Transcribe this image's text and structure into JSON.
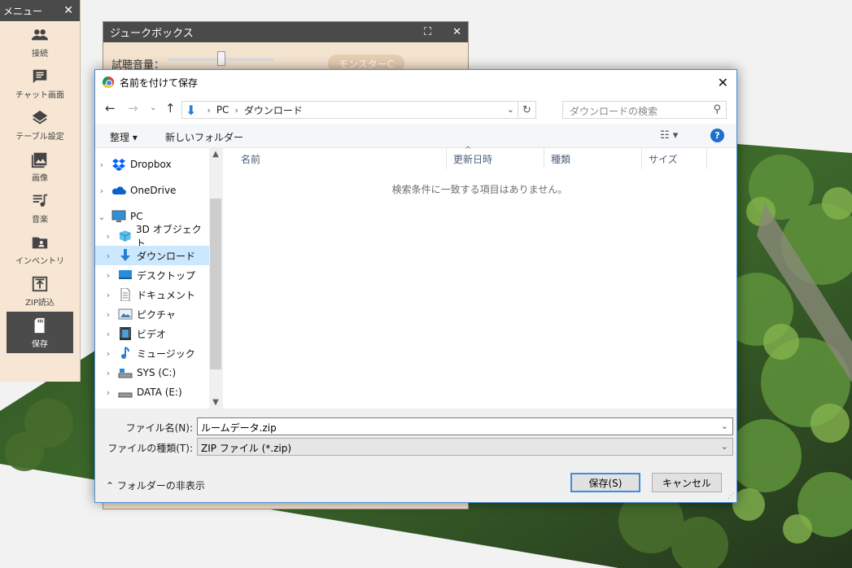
{
  "menu": {
    "title": "メニュー",
    "items": [
      {
        "label": "接続",
        "icon": "people-icon"
      },
      {
        "label": "チャット画面",
        "icon": "chat-icon"
      },
      {
        "label": "テーブル設定",
        "icon": "layers-icon"
      },
      {
        "label": "画像",
        "icon": "image-icon"
      },
      {
        "label": "音楽",
        "icon": "music-icon"
      },
      {
        "label": "インベントリ",
        "icon": "folder-person-icon"
      },
      {
        "label": "ZIP読込",
        "icon": "upload-icon"
      },
      {
        "label": "保存",
        "icon": "sd-card-icon",
        "active": true
      }
    ]
  },
  "jukebox": {
    "title": "ジュークボックス",
    "volume_label": "試聴音量：",
    "pill_label": "モンスターC"
  },
  "dialog": {
    "title": "名前を付けて保存",
    "address": {
      "root": "PC",
      "current": "ダウンロード"
    },
    "search_placeholder": "ダウンロードの検索",
    "commands": {
      "organize": "整理 ▾",
      "new_folder": "新しいフォルダー"
    },
    "nav_items": [
      {
        "label": "Dropbox",
        "icon": "dropbox-icon",
        "indent": 0
      },
      {
        "label": "OneDrive",
        "icon": "onedrive-icon",
        "indent": 0
      },
      {
        "label": "PC",
        "icon": "computer-icon",
        "indent": 0,
        "expanded": true
      },
      {
        "label": "3D オブジェクト",
        "icon": "cube-icon",
        "indent": 1
      },
      {
        "label": "ダウンロード",
        "icon": "download-arrow-icon",
        "indent": 1,
        "selected": true
      },
      {
        "label": "デスクトップ",
        "icon": "desktop-icon",
        "indent": 1
      },
      {
        "label": "ドキュメント",
        "icon": "document-icon",
        "indent": 1
      },
      {
        "label": "ピクチャ",
        "icon": "picture-icon",
        "indent": 1
      },
      {
        "label": "ビデオ",
        "icon": "video-icon",
        "indent": 1
      },
      {
        "label": "ミュージック",
        "icon": "music-note-icon",
        "indent": 1
      },
      {
        "label": "SYS (C:)",
        "icon": "drive-icon",
        "indent": 1
      },
      {
        "label": "DATA (E:)",
        "icon": "drive-icon",
        "indent": 1
      }
    ],
    "columns": [
      "名前",
      "更新日時",
      "種類",
      "サイズ"
    ],
    "empty_message": "検索条件に一致する項目はありません。",
    "filename_label": "ファイル名(N):",
    "filename_value": "ルームデータ.zip",
    "filetype_label": "ファイルの種類(T):",
    "filetype_value": "ZIP ファイル (*.zip)",
    "hide_folders": "フォルダーの非表示",
    "save_button": "保存(S)",
    "cancel_button": "キャンセル"
  }
}
